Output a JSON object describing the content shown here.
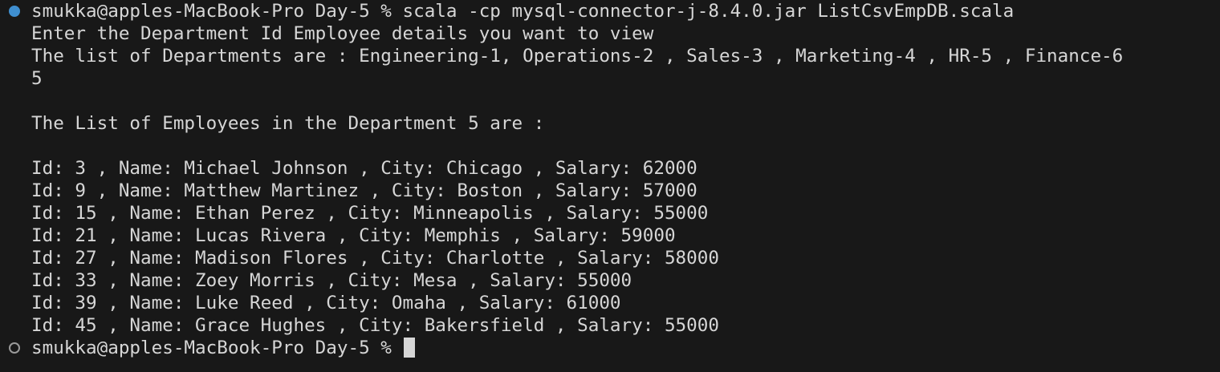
{
  "terminal": {
    "command_line": "smukka@apples-MacBook-Pro Day-5 % scala -cp mysql-connector-j-8.4.0.jar ListCsvEmpDB.scala",
    "output": [
      "Enter the Department Id Employee details you want to view",
      "The list of Departments are : Engineering-1, Operations-2 , Sales-3 , Marketing-4 , HR-5 , Finance-6",
      "5",
      "",
      "The List of Employees in the Department 5 are :",
      "",
      "Id: 3 , Name: Michael Johnson , City: Chicago , Salary: 62000",
      "Id: 9 , Name: Matthew Martinez , City: Boston , Salary: 57000",
      "Id: 15 , Name: Ethan Perez , City: Minneapolis , Salary: 55000",
      "Id: 21 , Name: Lucas Rivera , City: Memphis , Salary: 59000",
      "Id: 27 , Name: Madison Flores , City: Charlotte , Salary: 58000",
      "Id: 33 , Name: Zoey Morris , City: Mesa , Salary: 55000",
      "Id: 39 , Name: Luke Reed , City: Omaha , Salary: 61000",
      "Id: 45 , Name: Grace Hughes , City: Bakersfield , Salary: 55000"
    ],
    "prompt": "smukka@apples-MacBook-Pro Day-5 % ",
    "colors": {
      "background": "#181818",
      "text": "#d6d6d6",
      "success_marker": "#3f8fd0",
      "pending_marker": "#9a9a9a"
    }
  }
}
